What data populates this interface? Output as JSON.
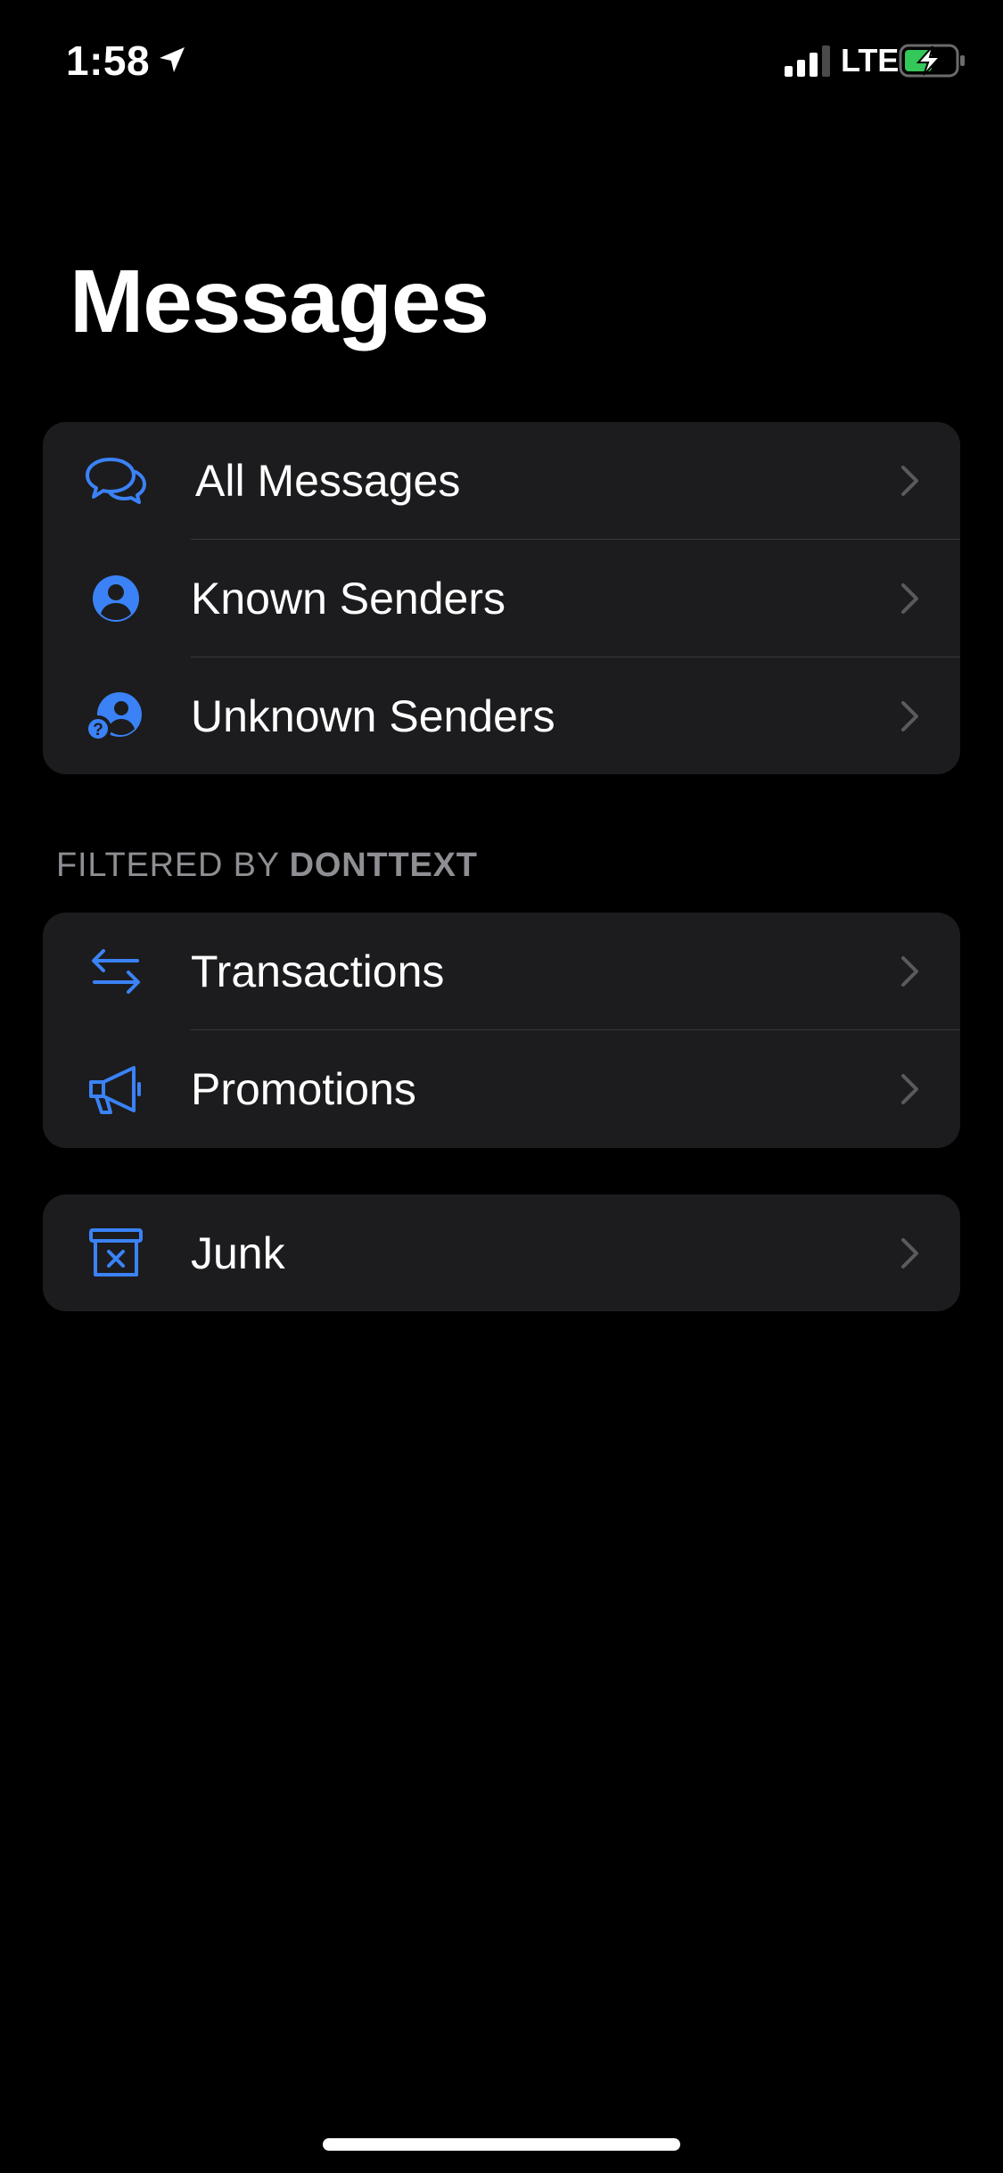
{
  "status_bar": {
    "time": "1:58",
    "network": "LTE"
  },
  "title": "Messages",
  "groups": {
    "main": [
      {
        "label": "All Messages",
        "icon": "chat-bubbles-icon"
      },
      {
        "label": "Known Senders",
        "icon": "person-circle-icon"
      },
      {
        "label": "Unknown Senders",
        "icon": "person-question-icon"
      }
    ],
    "filtered_header": {
      "prefix": "FILTERED BY",
      "brand": "DONTTEXT"
    },
    "filtered": [
      {
        "label": "Transactions",
        "icon": "arrows-left-right-icon"
      },
      {
        "label": "Promotions",
        "icon": "megaphone-icon"
      }
    ],
    "other": [
      {
        "label": "Junk",
        "icon": "junk-bin-icon"
      }
    ]
  },
  "colors": {
    "accent": "#3b82f6",
    "background": "#000000",
    "cell": "#1c1c1e",
    "secondary_text": "#8e8e93",
    "battery": "#34c759"
  }
}
